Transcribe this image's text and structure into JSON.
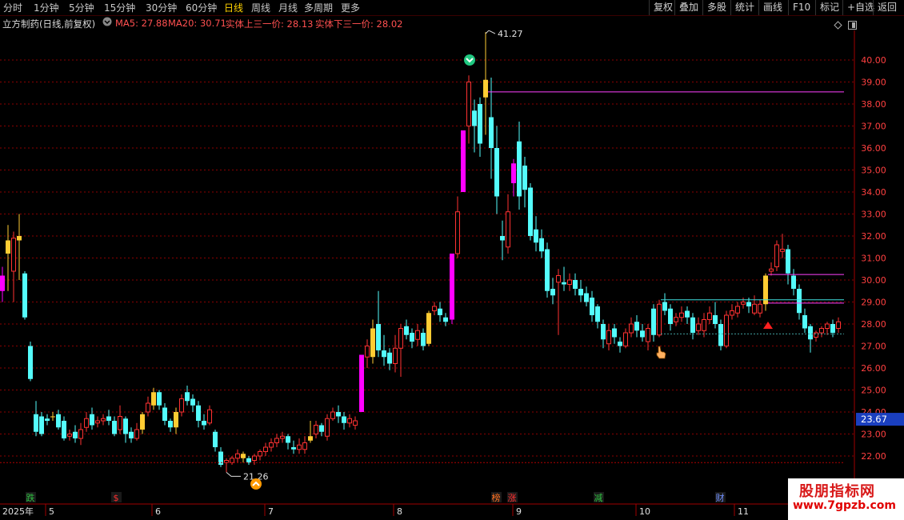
{
  "periods": [
    {
      "label": "分时"
    },
    {
      "label": "1分钟"
    },
    {
      "label": "5分钟"
    },
    {
      "label": "15分钟"
    },
    {
      "label": "30分钟"
    },
    {
      "label": "60分钟"
    },
    {
      "label": "日线",
      "active": true
    },
    {
      "label": "周线"
    },
    {
      "label": "月线"
    },
    {
      "label": "多周期"
    },
    {
      "label": "更多"
    }
  ],
  "tools": [
    {
      "label": "复权"
    },
    {
      "label": "叠加"
    },
    {
      "label": "多股"
    },
    {
      "label": "统计"
    },
    {
      "label": "画线"
    },
    {
      "label": "F10"
    },
    {
      "label": "标记"
    },
    {
      "label": "+自选"
    },
    {
      "label": "返回"
    }
  ],
  "header": {
    "stock_title": "立方制药(日线,前复权)",
    "ma5": "MA5: 27.88",
    "ma20": "MA20: 30.71",
    "upper": "实体上三一价: 28.13",
    "lower": "实体下三一价: 28.02"
  },
  "price_axis": [
    "40.00",
    "39.00",
    "38.00",
    "37.00",
    "36.00",
    "35.00",
    "34.00",
    "33.00",
    "32.00",
    "31.00",
    "30.00",
    "29.00",
    "28.00",
    "27.00",
    "26.00",
    "25.00",
    "24.00",
    "23.00",
    "22.00"
  ],
  "current_price": "23.67",
  "annotations": {
    "high": "41.27",
    "low": "21.26"
  },
  "time_axis": {
    "year": "2025年",
    "months": [
      "5",
      "6",
      "7",
      "8",
      "9",
      "10",
      "11"
    ]
  },
  "events": [
    {
      "label": "跌",
      "color": "#2ec040"
    },
    {
      "label": "$",
      "color": "#ff3030"
    },
    {
      "label": "榜",
      "color": "#ff7020"
    },
    {
      "label": "涨",
      "color": "#ff3030"
    },
    {
      "label": "减",
      "color": "#2ec040"
    },
    {
      "label": "财",
      "color": "#7090ff"
    }
  ],
  "watermark": {
    "title": "股朋指标网",
    "url": "www.7gpzb.com"
  },
  "colors": {
    "up": "#ff3232",
    "down": "#54fcfc",
    "grid": "#8b0000",
    "highlight_magenta": "#ff00ff",
    "highlight_yellow": "#ffcc33",
    "period_active": "#ffd200"
  },
  "icons": [
    "chevron-down-icon",
    "sell-signal-icon",
    "buy-signal-icon",
    "hand-cursor-icon",
    "up-triangle-icon",
    "diamond-icon",
    "panel-toggle-icon"
  ]
}
